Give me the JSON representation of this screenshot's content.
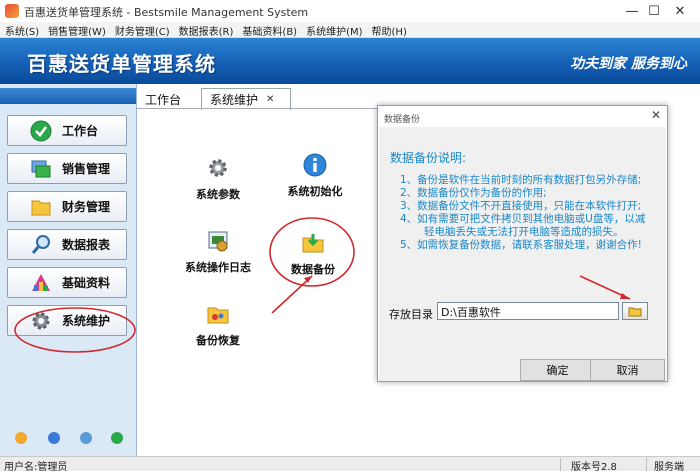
{
  "window": {
    "title": "百惠送货单管理系统 - Bestsmile Management System",
    "minimize": "—",
    "maximize": "☐",
    "close": "✕"
  },
  "menu": [
    "系统(S)",
    "销售管理(W)",
    "财务管理(C)",
    "数据报表(R)",
    "基础资料(B)",
    "系统维护(M)",
    "帮助(H)"
  ],
  "banner": {
    "title": "百惠送货单管理系统",
    "slogan": "功夫到家 服务到心"
  },
  "sidebar": {
    "items": [
      {
        "label": "工作台",
        "icon": "check-circle-icon"
      },
      {
        "label": "销售管理",
        "icon": "window-stack-icon"
      },
      {
        "label": "财务管理",
        "icon": "folder-icon"
      },
      {
        "label": "数据报表",
        "icon": "magnifier-icon"
      },
      {
        "label": "基础资料",
        "icon": "chart-icon"
      },
      {
        "label": "系统维护",
        "icon": "gear-icon"
      }
    ],
    "bottom_icons": [
      "note-icon",
      "clock-icon",
      "search-icon",
      "back-icon"
    ]
  },
  "tabs": [
    {
      "label": "工作台"
    },
    {
      "label": "系统维护",
      "close": "✕"
    }
  ],
  "workspace": {
    "items": [
      {
        "label": "系统参数",
        "icon": "gear-icon"
      },
      {
        "label": "系统初始化",
        "icon": "info-icon"
      },
      {
        "label": "系统操作日志",
        "icon": "log-icon"
      },
      {
        "label": "数据备份",
        "icon": "backup-icon"
      },
      {
        "label": "备份恢复",
        "icon": "restore-icon"
      }
    ]
  },
  "dialog": {
    "title": "数据备份",
    "close": "✕",
    "heading": "数据备份说明:",
    "lines": [
      "1、备份是软件在当前时刻的所有数据打包另外存储;",
      "2、数据备份仅作为备份的作用;",
      "3、数据备份文件不开直接使用，只能在本软件打开;",
      "4、如有需要可把文件拷贝到其他电脑或U盘等，以减",
      "轻电脑丢失或无法打开电脑等造成的损失。",
      "5、如需恢复备份数据，请联系客服处理，谢谢合作!"
    ],
    "dir_label": "存放目录",
    "dir_value": "D:\\百惠软件",
    "ok": "确定",
    "cancel": "取消"
  },
  "status": {
    "user": "用户名:管理员",
    "version": "版本号2.8",
    "side": "服务端"
  },
  "colors": {
    "banner": "#1560b6",
    "dialog_text": "#1a87c7",
    "annotation": "#d0292e"
  }
}
